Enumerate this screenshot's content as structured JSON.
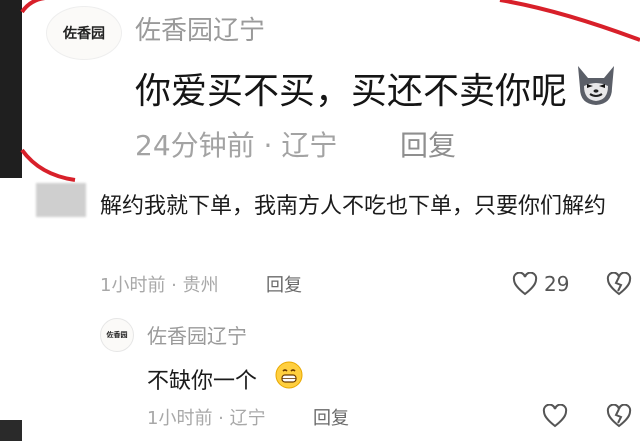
{
  "top_comment": {
    "avatar_text": "佐香园",
    "username": "佐香园辽宁",
    "text": "你爱买不买，买还不卖你呢",
    "meta": "24分钟前 · 辽宁",
    "reply_label": "回复"
  },
  "comment": {
    "text": "解约我就下单，我南方人不吃也下单，只要你们解约",
    "meta": "1小时前 · 贵州",
    "reply_label": "回复",
    "like_count": "29"
  },
  "reply": {
    "avatar_text": "佐香园",
    "username": "佐香园辽宁",
    "text": "不缺你一个",
    "meta": "1小时前 · 辽宁",
    "reply_label": "回复"
  },
  "colors": {
    "highlight_red": "#d8202a",
    "meta_gray": "#a8a8a8"
  },
  "icons": [
    "heart-icon",
    "broken-heart-icon",
    "wolf-emoji-icon",
    "grin-emoji-icon"
  ]
}
